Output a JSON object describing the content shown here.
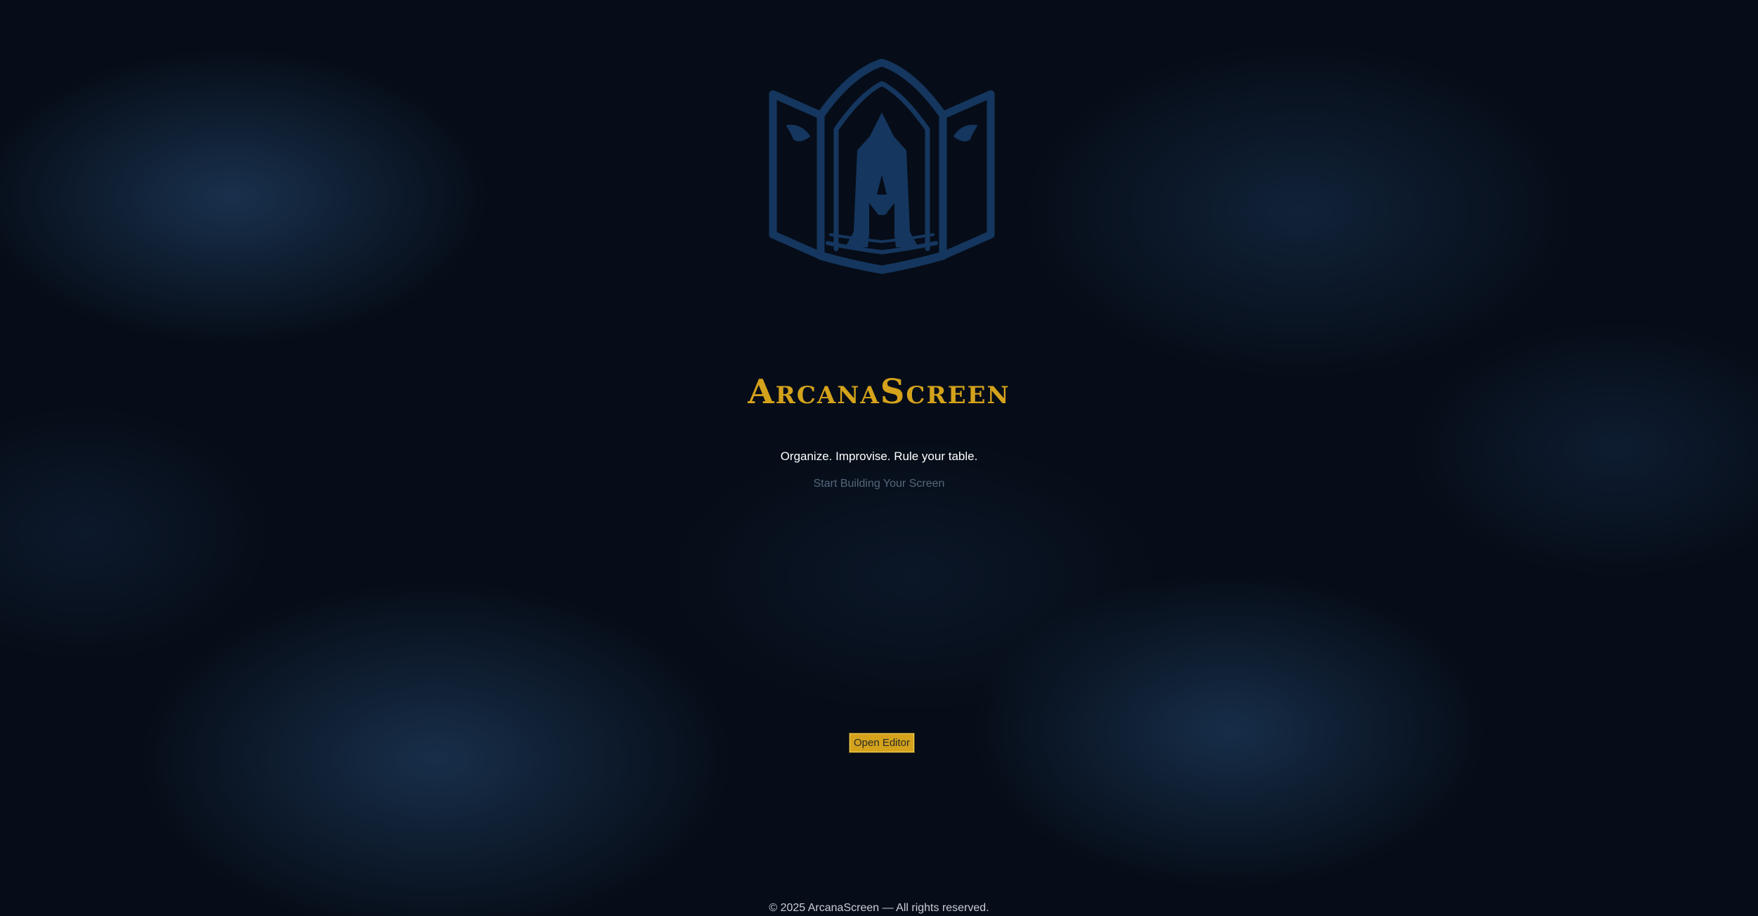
{
  "brand": {
    "title": "ArcanaScreen",
    "logo_icon": "arcana-book-shield-icon",
    "accent_color": "#d4a21b",
    "logo_color": "#15365e"
  },
  "hero": {
    "tagline": "Organize. Improvise. Rule your table.",
    "start_link": "Start Building Your Screen"
  },
  "actions": {
    "open_editor_label": "Open Editor"
  },
  "footer": {
    "copyright": "© 2025 ArcanaScreen — All rights reserved."
  }
}
